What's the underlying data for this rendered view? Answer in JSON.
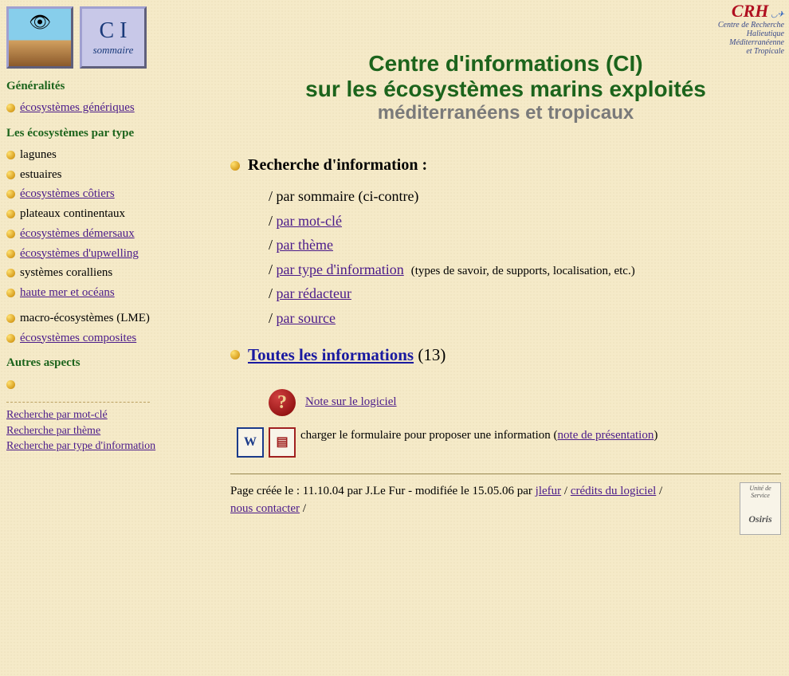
{
  "sidebar": {
    "logo_ci_big": "C I",
    "logo_ci_small": "sommaire",
    "heading_generalites": "Généralités",
    "generalites_items": [
      "écosystèmes génériques"
    ],
    "heading_type": "Les écosystèmes par type",
    "type_items": [
      {
        "label": "lagunes",
        "link": false
      },
      {
        "label": "estuaires",
        "link": false
      },
      {
        "label": "écosystèmes côtiers",
        "link": true
      },
      {
        "label": "plateaux continentaux",
        "link": false
      },
      {
        "label": "écosystèmes démersaux",
        "link": true
      },
      {
        "label": "écosystèmes d'upwelling",
        "link": true
      },
      {
        "label": "systèmes coralliens",
        "link": false
      },
      {
        "label": "haute mer et océans",
        "link": true
      }
    ],
    "type_items2": [
      {
        "label": "macro-écosystèmes (LME)",
        "link": false
      },
      {
        "label": "écosystèmes composites",
        "link": true
      }
    ],
    "heading_autres": "Autres aspects",
    "search_links": [
      "Recherche par mot-clé",
      "Recherche par thème",
      "Recherche par type d'information"
    ]
  },
  "crh": {
    "abbr": "CRH",
    "line1": "Centre de Recherche",
    "line2": "Halieutique",
    "line3": "Méditerranéenne",
    "line4": "et Tropicale"
  },
  "title": {
    "line1": "Centre d'informations (CI)",
    "line2": "sur les écosystèmes marins exploités",
    "line3": "méditerranéens et tropicaux"
  },
  "search": {
    "heading": "Recherche d'information :",
    "by_sommaire": "par sommaire (ci-contre)",
    "by_motcle": "par mot-clé",
    "by_theme": "par thème",
    "by_type": "par type d'information",
    "by_type_note": "(types de savoir, de supports, localisation, etc.)",
    "by_redacteur": "par rédacteur",
    "by_source": "par source"
  },
  "all_info": {
    "label": "Toutes les informations",
    "count": "(13)"
  },
  "note": {
    "label": "Note sur le logiciel"
  },
  "form": {
    "text": "charger le formulaire pour proposer une information (",
    "link": "note de présentation",
    "close": ")"
  },
  "footer": {
    "prefix": "Page créée le : 11.10.04 par J.Le Fur - modifiée le 15.05.06 par ",
    "link1": "jlefur",
    "link2": "crédits du logiciel",
    "link3": "nous contacter",
    "sep": " / "
  },
  "osiris": {
    "l1": "Unité de",
    "l2": "Service",
    "l3": "Osiris"
  }
}
